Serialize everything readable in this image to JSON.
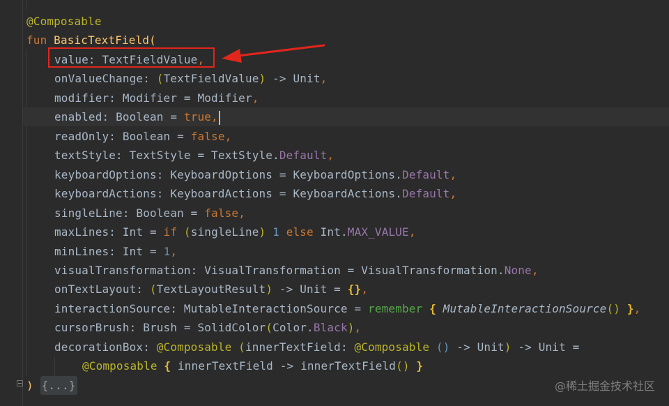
{
  "editor": {
    "annotation": "@Composable",
    "signature": {
      "fun_keyword": "fun",
      "function_name": "BasicTextField",
      "open_paren": "("
    },
    "params": {
      "value": {
        "name": "value",
        "sep": ": ",
        "type": "TextFieldValue",
        "tail": ","
      },
      "onValueChange": {
        "name": "onValueChange",
        "sep": ": ",
        "p_open": "(",
        "type": "TextFieldValue",
        "p_close": ")",
        "arrow": " -> ",
        "ret": "Unit",
        "tail": ","
      },
      "modifier": {
        "name": "modifier",
        "sep": ": ",
        "type": "Modifier",
        "eq": " = ",
        "default": "Modifier",
        "tail": ","
      },
      "enabled": {
        "name": "enabled",
        "sep": ": ",
        "type": "Boolean",
        "eq": " = ",
        "default": "true",
        "tail": ","
      },
      "readOnly": {
        "name": "readOnly",
        "sep": ": ",
        "type": "Boolean",
        "eq": " = ",
        "default": "false",
        "tail": ","
      },
      "textStyle": {
        "name": "textStyle",
        "sep": ": ",
        "type": "TextStyle",
        "eq": " = ",
        "default_obj": "TextStyle",
        "dot": ".",
        "default_prop": "Default",
        "tail": ","
      },
      "keyboardOptions": {
        "name": "keyboardOptions",
        "sep": ": ",
        "type": "KeyboardOptions",
        "eq": " = ",
        "default_obj": "KeyboardOptions",
        "dot": ".",
        "default_prop": "Default",
        "tail": ","
      },
      "keyboardActions": {
        "name": "keyboardActions",
        "sep": ": ",
        "type": "KeyboardActions",
        "eq": " = ",
        "default_obj": "KeyboardActions",
        "dot": ".",
        "default_prop": "Default",
        "tail": ","
      },
      "singleLine": {
        "name": "singleLine",
        "sep": ": ",
        "type": "Boolean",
        "eq": " = ",
        "default": "false",
        "tail": ","
      },
      "maxLines": {
        "name": "maxLines",
        "sep": ": ",
        "type": "Int",
        "eq": " = ",
        "if_kw": "if",
        "p_open": " (",
        "cond": "singleLine",
        "p_close": ")",
        "one": " 1",
        "else_kw": " else",
        "int_obj": " Int",
        "dot": ".",
        "max": "MAX_VALUE",
        "tail": ","
      },
      "minLines": {
        "name": "minLines",
        "sep": ": ",
        "type": "Int",
        "eq": " = ",
        "default": "1",
        "tail": ","
      },
      "visualTransformation": {
        "name": "visualTransformation",
        "sep": ": ",
        "type": "VisualTransformation",
        "eq": " = ",
        "default_obj": "VisualTransformation",
        "dot": ".",
        "default_prop": "None",
        "tail": ","
      },
      "onTextLayout": {
        "name": "onTextLayout",
        "sep": ": ",
        "p_open": "(",
        "type": "TextLayoutResult",
        "p_close": ")",
        "arrow": " -> ",
        "ret": "Unit",
        "eq": " = ",
        "lambda": "{}",
        "tail": ","
      },
      "interactionSource": {
        "name": "interactionSource",
        "sep": ": ",
        "type": "MutableInteractionSource",
        "eq": " = ",
        "remember": "remember",
        "b_open": " {",
        "call": " MutableInteractionSource",
        "call_parens": "()",
        "b_close": " }",
        "tail": ","
      },
      "cursorBrush": {
        "name": "cursorBrush",
        "sep": ": ",
        "type": "Brush",
        "eq": " = ",
        "ctor": "SolidColor",
        "p_open": "(",
        "color_obj": "Color",
        "dot": ".",
        "color_prop": "Black",
        "p_close": ")",
        "tail": ","
      },
      "decorationBox": {
        "name": "decorationBox",
        "sep": ": ",
        "ann": "@Composable",
        "p_open": " (",
        "inner_name": "innerTextField",
        "inner_sep": ": ",
        "inner_ann": "@Composable",
        "inner_parens": " ()",
        "inner_arrow": " -> ",
        "inner_ret": "Unit",
        "p_close": ")",
        "arrow": " -> ",
        "ret": "Unit",
        "eq": " =",
        "line2": {
          "ann": "@Composable",
          "b_open": " {",
          "lhs": " innerTextField",
          "arrow": " -> ",
          "rhs": "innerTextField",
          "call_parens": "()",
          "b_close": " }"
        }
      }
    },
    "closing": {
      "paren": ")",
      "folded": "{...}"
    }
  },
  "watermark": "@稀土掘金技术社区",
  "colors": {
    "background": "#2b2b2b",
    "keyword": "#cc7832",
    "annotation": "#bbb529",
    "function": "#ffc66d",
    "number": "#6897bb",
    "property": "#9876aa",
    "highlight_box": "#e1261c"
  }
}
